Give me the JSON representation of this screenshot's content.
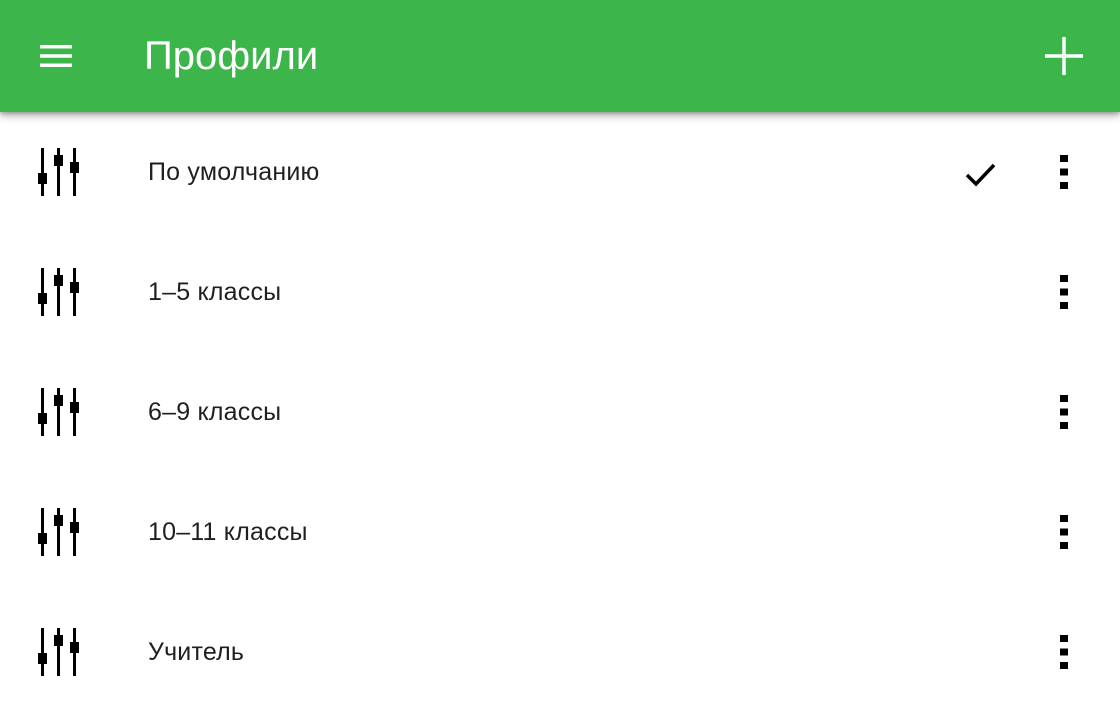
{
  "appbar": {
    "title": "Профили",
    "menu_icon": "menu-icon",
    "add_icon": "add-icon",
    "color": "#3cb54a"
  },
  "profiles": [
    {
      "label": "По умолчанию",
      "selected": true
    },
    {
      "label": "1–5 классы",
      "selected": false
    },
    {
      "label": "6–9 классы",
      "selected": false
    },
    {
      "label": "10–11 классы",
      "selected": false
    },
    {
      "label": "Учитель",
      "selected": false
    }
  ],
  "icons": {
    "leading": "equalizer-icon",
    "selected": "check-icon",
    "overflow": "more-vert-icon"
  }
}
